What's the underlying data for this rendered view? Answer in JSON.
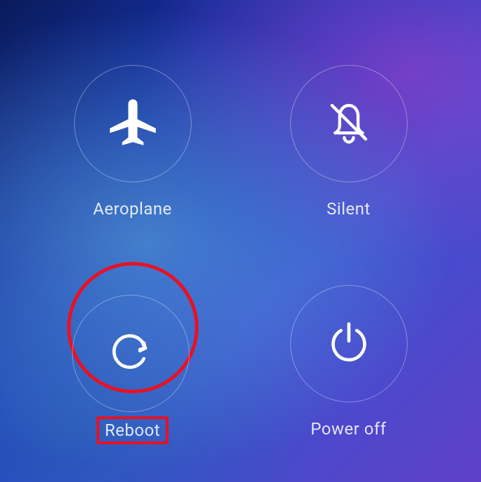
{
  "power_menu": {
    "options": [
      {
        "id": "aeroplane",
        "label": "Aeroplane"
      },
      {
        "id": "silent",
        "label": "Silent"
      },
      {
        "id": "reboot",
        "label": "Reboot"
      },
      {
        "id": "poweroff",
        "label": "Power off"
      }
    ]
  },
  "annotations": {
    "highlighted_option": "reboot",
    "highlight_color": "#e81123"
  }
}
